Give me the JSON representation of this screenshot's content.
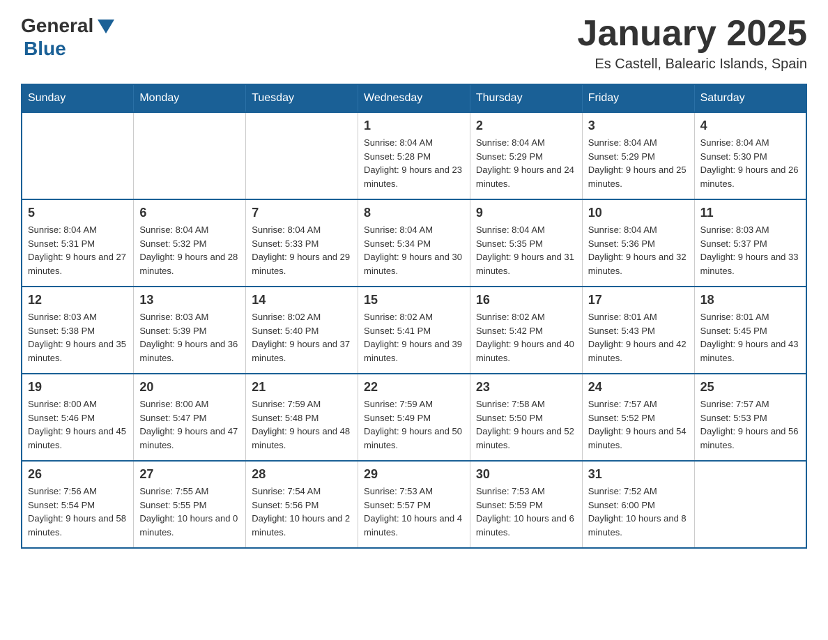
{
  "header": {
    "logo": {
      "general": "General",
      "blue": "Blue"
    },
    "title": "January 2025",
    "location": "Es Castell, Balearic Islands, Spain"
  },
  "days_of_week": [
    "Sunday",
    "Monday",
    "Tuesday",
    "Wednesday",
    "Thursday",
    "Friday",
    "Saturday"
  ],
  "weeks": [
    [
      {
        "day": "",
        "info": ""
      },
      {
        "day": "",
        "info": ""
      },
      {
        "day": "",
        "info": ""
      },
      {
        "day": "1",
        "info": "Sunrise: 8:04 AM\nSunset: 5:28 PM\nDaylight: 9 hours and 23 minutes."
      },
      {
        "day": "2",
        "info": "Sunrise: 8:04 AM\nSunset: 5:29 PM\nDaylight: 9 hours and 24 minutes."
      },
      {
        "day": "3",
        "info": "Sunrise: 8:04 AM\nSunset: 5:29 PM\nDaylight: 9 hours and 25 minutes."
      },
      {
        "day": "4",
        "info": "Sunrise: 8:04 AM\nSunset: 5:30 PM\nDaylight: 9 hours and 26 minutes."
      }
    ],
    [
      {
        "day": "5",
        "info": "Sunrise: 8:04 AM\nSunset: 5:31 PM\nDaylight: 9 hours and 27 minutes."
      },
      {
        "day": "6",
        "info": "Sunrise: 8:04 AM\nSunset: 5:32 PM\nDaylight: 9 hours and 28 minutes."
      },
      {
        "day": "7",
        "info": "Sunrise: 8:04 AM\nSunset: 5:33 PM\nDaylight: 9 hours and 29 minutes."
      },
      {
        "day": "8",
        "info": "Sunrise: 8:04 AM\nSunset: 5:34 PM\nDaylight: 9 hours and 30 minutes."
      },
      {
        "day": "9",
        "info": "Sunrise: 8:04 AM\nSunset: 5:35 PM\nDaylight: 9 hours and 31 minutes."
      },
      {
        "day": "10",
        "info": "Sunrise: 8:04 AM\nSunset: 5:36 PM\nDaylight: 9 hours and 32 minutes."
      },
      {
        "day": "11",
        "info": "Sunrise: 8:03 AM\nSunset: 5:37 PM\nDaylight: 9 hours and 33 minutes."
      }
    ],
    [
      {
        "day": "12",
        "info": "Sunrise: 8:03 AM\nSunset: 5:38 PM\nDaylight: 9 hours and 35 minutes."
      },
      {
        "day": "13",
        "info": "Sunrise: 8:03 AM\nSunset: 5:39 PM\nDaylight: 9 hours and 36 minutes."
      },
      {
        "day": "14",
        "info": "Sunrise: 8:02 AM\nSunset: 5:40 PM\nDaylight: 9 hours and 37 minutes."
      },
      {
        "day": "15",
        "info": "Sunrise: 8:02 AM\nSunset: 5:41 PM\nDaylight: 9 hours and 39 minutes."
      },
      {
        "day": "16",
        "info": "Sunrise: 8:02 AM\nSunset: 5:42 PM\nDaylight: 9 hours and 40 minutes."
      },
      {
        "day": "17",
        "info": "Sunrise: 8:01 AM\nSunset: 5:43 PM\nDaylight: 9 hours and 42 minutes."
      },
      {
        "day": "18",
        "info": "Sunrise: 8:01 AM\nSunset: 5:45 PM\nDaylight: 9 hours and 43 minutes."
      }
    ],
    [
      {
        "day": "19",
        "info": "Sunrise: 8:00 AM\nSunset: 5:46 PM\nDaylight: 9 hours and 45 minutes."
      },
      {
        "day": "20",
        "info": "Sunrise: 8:00 AM\nSunset: 5:47 PM\nDaylight: 9 hours and 47 minutes."
      },
      {
        "day": "21",
        "info": "Sunrise: 7:59 AM\nSunset: 5:48 PM\nDaylight: 9 hours and 48 minutes."
      },
      {
        "day": "22",
        "info": "Sunrise: 7:59 AM\nSunset: 5:49 PM\nDaylight: 9 hours and 50 minutes."
      },
      {
        "day": "23",
        "info": "Sunrise: 7:58 AM\nSunset: 5:50 PM\nDaylight: 9 hours and 52 minutes."
      },
      {
        "day": "24",
        "info": "Sunrise: 7:57 AM\nSunset: 5:52 PM\nDaylight: 9 hours and 54 minutes."
      },
      {
        "day": "25",
        "info": "Sunrise: 7:57 AM\nSunset: 5:53 PM\nDaylight: 9 hours and 56 minutes."
      }
    ],
    [
      {
        "day": "26",
        "info": "Sunrise: 7:56 AM\nSunset: 5:54 PM\nDaylight: 9 hours and 58 minutes."
      },
      {
        "day": "27",
        "info": "Sunrise: 7:55 AM\nSunset: 5:55 PM\nDaylight: 10 hours and 0 minutes."
      },
      {
        "day": "28",
        "info": "Sunrise: 7:54 AM\nSunset: 5:56 PM\nDaylight: 10 hours and 2 minutes."
      },
      {
        "day": "29",
        "info": "Sunrise: 7:53 AM\nSunset: 5:57 PM\nDaylight: 10 hours and 4 minutes."
      },
      {
        "day": "30",
        "info": "Sunrise: 7:53 AM\nSunset: 5:59 PM\nDaylight: 10 hours and 6 minutes."
      },
      {
        "day": "31",
        "info": "Sunrise: 7:52 AM\nSunset: 6:00 PM\nDaylight: 10 hours and 8 minutes."
      },
      {
        "day": "",
        "info": ""
      }
    ]
  ]
}
